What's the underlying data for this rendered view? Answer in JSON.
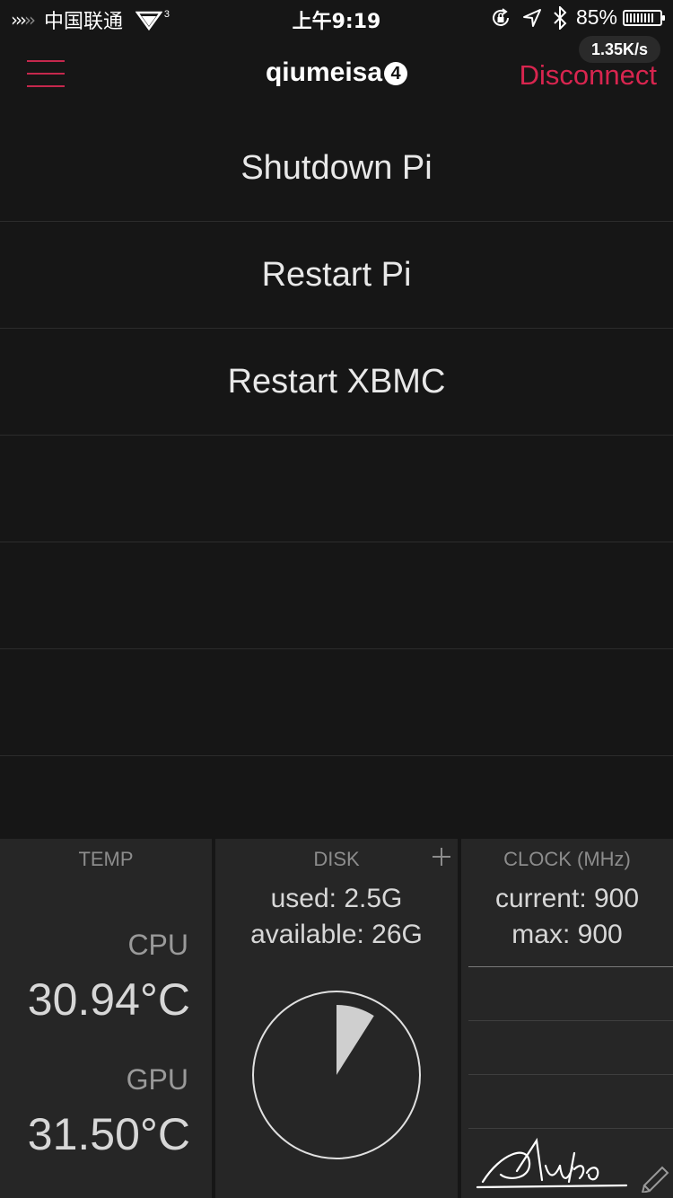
{
  "status_bar": {
    "carrier": "中国联通",
    "wifi_badge": "3",
    "time": "上午9:19",
    "battery_percent": "85%",
    "battery_level": 0.85,
    "icons": [
      "signal-chevrons-icon",
      "wifi-icon",
      "rotation-lock-icon",
      "location-icon",
      "bluetooth-icon",
      "battery-icon"
    ]
  },
  "network_speed": "1.35K/s",
  "header": {
    "title": "qiumeisa",
    "badge": "4",
    "disconnect_label": "Disconnect",
    "accent_color": "#d8254f"
  },
  "actions": [
    {
      "label": "Shutdown Pi"
    },
    {
      "label": "Restart Pi"
    },
    {
      "label": "Restart XBMC"
    },
    {
      "label": ""
    },
    {
      "label": ""
    },
    {
      "label": ""
    }
  ],
  "temp": {
    "title": "TEMP",
    "cpu_label": "CPU",
    "cpu_value": "30.94°C",
    "gpu_label": "GPU",
    "gpu_value": "31.50°C"
  },
  "disk": {
    "title": "DISK",
    "used": "used: 2.5G",
    "available": "available: 26G",
    "used_fraction": 0.09
  },
  "clock": {
    "title": "CLOCK (MHz)",
    "current": "current: 900",
    "max": "max: 900"
  },
  "signature_text": "Aiyko"
}
